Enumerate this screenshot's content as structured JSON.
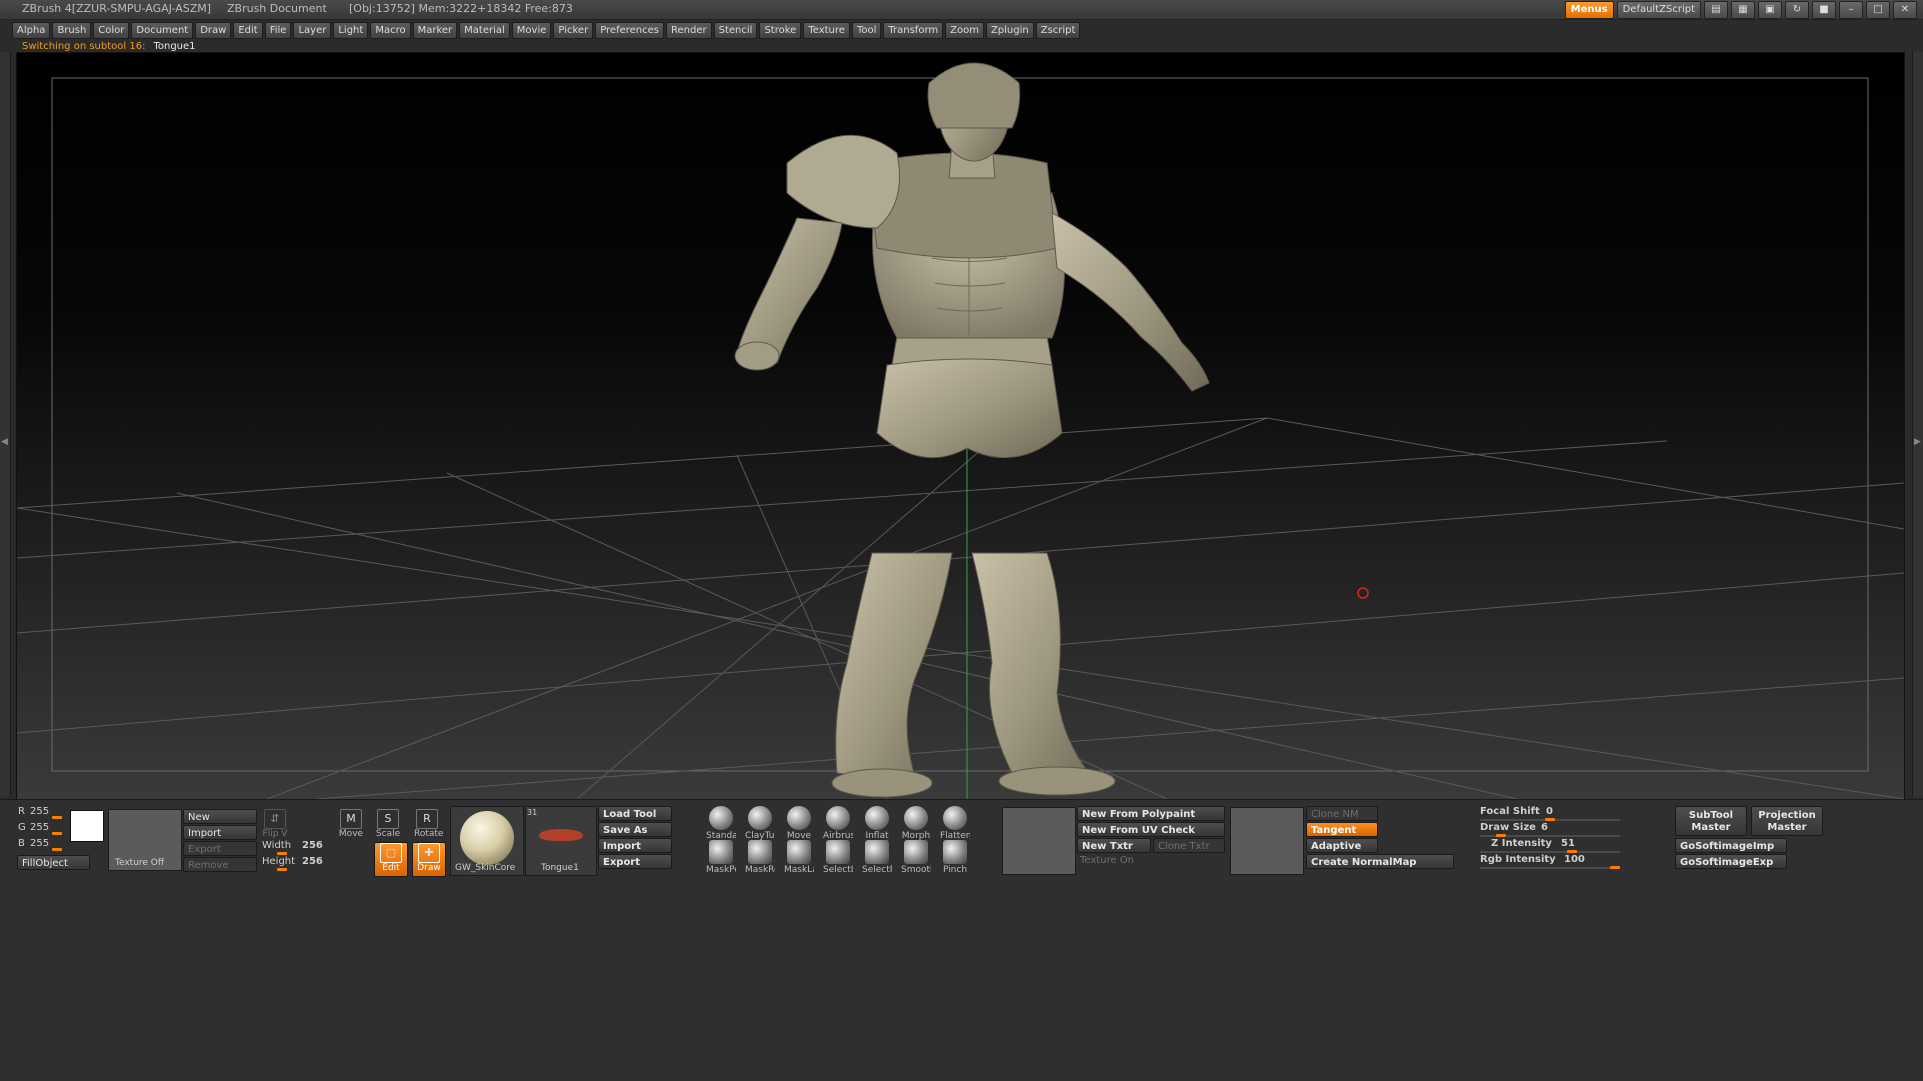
{
  "window": {
    "app_title": "ZBrush 4[ZZUR-SMPU-AGAJ-ASZM]",
    "document_title": "ZBrush Document",
    "stats": "[Obj:13752] Mem:3222+18342 Free:873",
    "menus_label": "Menus",
    "script_label": "DefaultZScript"
  },
  "menus": [
    "Alpha",
    "Brush",
    "Color",
    "Document",
    "Draw",
    "Edit",
    "File",
    "Layer",
    "Light",
    "Macro",
    "Marker",
    "Material",
    "Movie",
    "Picker",
    "Preferences",
    "Render",
    "Stencil",
    "Stroke",
    "Texture",
    "Tool",
    "Transform",
    "Zoom",
    "Zplugin",
    "Zscript"
  ],
  "notice": {
    "message": "Switching on subtool 16:",
    "subtool": "Tongue1"
  },
  "colors": {
    "accent": "#ff8f20",
    "canvas_top": "#000000",
    "model": "#a49d86"
  },
  "color_panel": {
    "r_label": "R",
    "r_value": "255",
    "g_label": "G",
    "g_value": "255",
    "b_label": "B",
    "b_value": "255",
    "fill_object": "FillObject"
  },
  "texture_panel": {
    "texture_label": "Texture Off",
    "new": "New",
    "import": "Import",
    "export": "Export",
    "remove": "Remove",
    "flip_v": "Flip V",
    "width_label": "Width",
    "width_value": "256",
    "height_label": "Height",
    "height_value": "256"
  },
  "transform": {
    "move": "Move",
    "scale": "Scale",
    "rotate": "Rotate",
    "edit": "Edit",
    "draw": "Draw"
  },
  "material": {
    "name": "GW_SkinCore"
  },
  "tool": {
    "name": "Tongue1",
    "count": "31"
  },
  "tool_buttons": {
    "load": "Load Tool",
    "save_as": "Save As",
    "import": "Import",
    "export": "Export"
  },
  "brushes_row1": [
    "Standar",
    "ClayTub",
    "Move",
    "Airbrush",
    "Inflat",
    "Morph",
    "Flatten"
  ],
  "brushes_row2": [
    "MaskPer",
    "MaskRe",
    "MaskLa",
    "SelectLa",
    "SelectRe",
    "Smooth",
    "Pinch"
  ],
  "polypaint": {
    "new_from_polypaint": "New From Polypaint",
    "new_from_uv_check": "New From UV Check",
    "new_txtr": "New Txtr",
    "clone_txtr": "Clone Txtr",
    "texture_on": "Texture On"
  },
  "normalmap": {
    "clone_nm": "Clone NM",
    "tangent": "Tangent",
    "adaptive": "Adaptive",
    "create_normalmap": "Create NormalMap"
  },
  "draw_settings": {
    "focal_shift_label": "Focal Shift",
    "focal_shift_value": "0",
    "draw_size_label": "Draw Size",
    "draw_size_value": "6",
    "z_intensity_label": "Z Intensity",
    "z_intensity_value": "51",
    "rgb_intensity_label": "Rgb Intensity",
    "rgb_intensity_value": "100"
  },
  "plugins": {
    "subtool_master": "SubTool Master",
    "projection_master": "Projection Master",
    "go_softimage_imp": "GoSoftimageImp",
    "go_softimage_exp": "GoSoftimageExp"
  }
}
